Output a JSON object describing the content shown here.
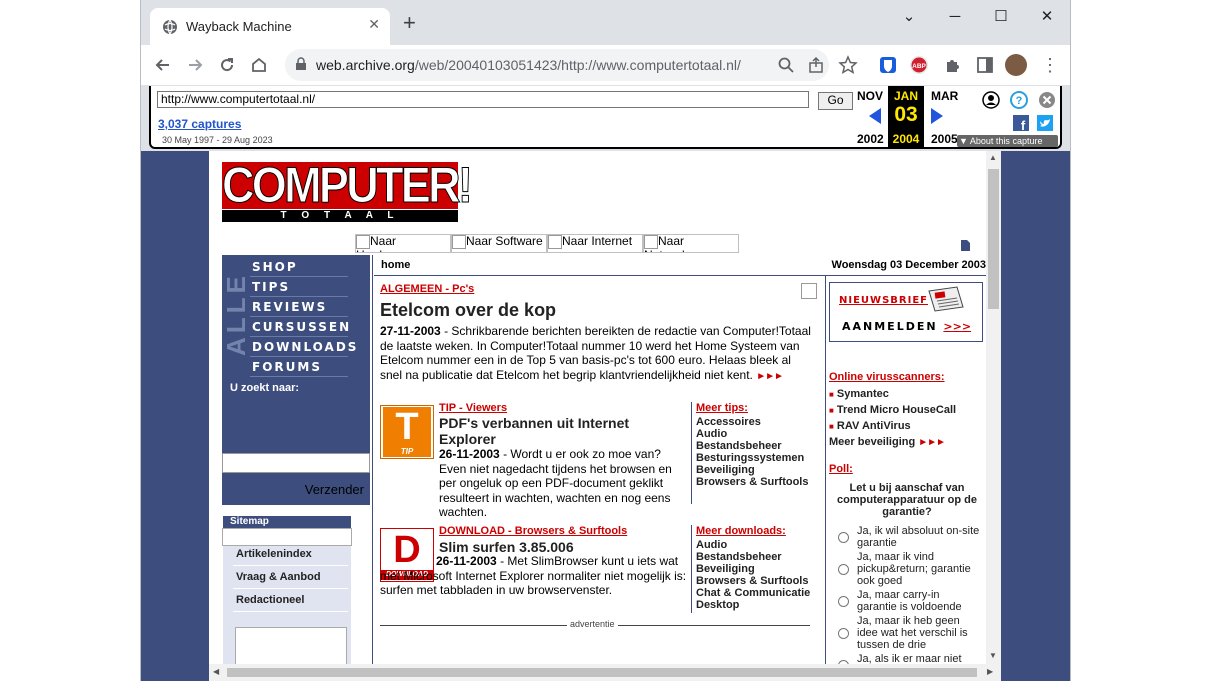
{
  "browser": {
    "tab_title": "Wayback Machine",
    "tab_close": "✕",
    "new_tab": "+",
    "url_host": "web.archive.org",
    "url_path": "/web/20040103051423/http://www.computertotaal.nl/",
    "window_buttons": {
      "minimize": "─",
      "maximize": "☐",
      "close": "✕"
    }
  },
  "wayback": {
    "url_input": "http://www.computertotaal.nl/",
    "go_label": "Go",
    "captures_link": "3,037 captures",
    "capture_range": "30 May 1997 - 29 Aug 2023",
    "prev_month": "NOV",
    "prev_year": "2002",
    "cur_month": "JAN",
    "cur_day": "03",
    "cur_year": "2004",
    "next_month": "MAR",
    "next_year": "2005",
    "about_label": "▼ About this capture"
  },
  "site": {
    "logo_text": "COMPUTER!",
    "logo_sub": "T O T A A L",
    "top_nav": [
      "Naar Hardware",
      "Naar Software",
      "Naar Internet",
      "Naar Netwerken"
    ],
    "menu_alle": "ALLE",
    "menu": [
      "SHOP",
      "TIPS",
      "REVIEWS",
      "CURSUSSEN",
      "DOWNLOADS",
      "FORUMS"
    ],
    "search_label": "U zoekt naar:",
    "search_button": "Verzender",
    "sitemap_title": "Sitemap",
    "sitemap_links": [
      "Artikelenindex",
      "Vraag & Aanbod",
      "Redactioneel"
    ],
    "breadcrumb": "home",
    "date": "Woensdag 03 December 2003",
    "article": {
      "category": "ALGEMEEN - Pc's",
      "title": "Etelcom over de kop",
      "date": "27-11-2003",
      "body": " - Schrikbarende berichten bereikten de redactie van Computer!Totaal de laatste weken. In Computer!Totaal nummer 10 werd het Home Systeem van Etelcom nummer een in de Top 5 van basis-pc's tot 600 euro. Helaas bleek al snel na publicatie dat Etelcom het begrip klantvriendelijkheid niet kent."
    },
    "tip": {
      "badge_letter": "T",
      "badge_label": "TIP",
      "category": "TIP - Viewers",
      "title": "PDF's verbannen uit Internet Explorer",
      "date": "26-11-2003",
      "body": " - Wordt u er ook zo moe van? Even niet nagedacht tijdens het browsen en per ongeluk op een PDF-document geklikt resulteert in wachten, wachten en nog eens wachten."
    },
    "more_tips": {
      "title": "Meer tips:",
      "items": [
        "Accessoires",
        "Audio",
        "Bestandsbeheer",
        "Besturingssystemen",
        "Beveiliging",
        "Browsers & Surftools"
      ]
    },
    "download": {
      "badge_letter": "D",
      "badge_label": "DOWNLOAD",
      "category": "DOWNLOAD - Browsers & Surftools",
      "title": "Slim surfen 3.85.006",
      "date": "26-11-2003",
      "body": " - Met SlimBrowser kunt u iets wat met Microsoft Internet Explorer normaliter niet mogelijk is: surfen met tabbladen in uw browservenster."
    },
    "more_downloads": {
      "title": "Meer downloads:",
      "items": [
        "Audio",
        "Bestandsbeheer",
        "Beveiliging",
        "Browsers & Surftools",
        "Chat & Communicatie",
        "Desktop"
      ]
    },
    "advert": "advertentie",
    "more_marker": "►►►",
    "newsletter_title": "NIEUWSBRIEF",
    "newsletter_sub": "AANMELDEN",
    "newsletter_arrows": ">>>",
    "virus_title": "Online virusscanners:",
    "virus_items": [
      "Symantec",
      "Trend Micro HouseCall",
      "RAV AntiVirus"
    ],
    "security_more": "Meer beveiliging",
    "poll_title": "Poll:",
    "poll_question": "Let u bij aanschaf van computerapparatuur op de garantie?",
    "poll_options": [
      "Ja, ik wil absoluut on-site garantie",
      "Ja, maar ik vind pickup&return; garantie ook goed",
      "Ja, maar carry-in garantie is voldoende",
      "Ja, maar ik heb geen idee wat het verschil is tussen de drie",
      "Ja, als ik er maar niet"
    ]
  },
  "colors": {
    "site_blue": "#3d4e7e",
    "accent_red": "#cc0000",
    "wb_yellow": "#ffe800"
  }
}
